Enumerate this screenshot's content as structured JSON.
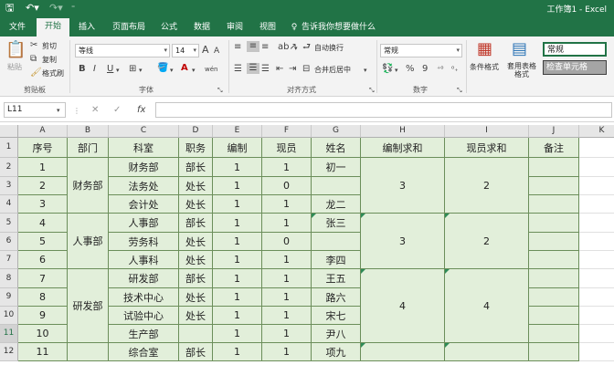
{
  "titlebar": {
    "save_icon": "save-icon",
    "undo_icon": "undo-icon",
    "redo_icon": "redo-icon",
    "title": "工作簿1 - Excel"
  },
  "tabs": [
    "文件",
    "开始",
    "插入",
    "页面布局",
    "公式",
    "数据",
    "审阅",
    "视图"
  ],
  "tell_me": "告诉我你想要做什么",
  "ribbon": {
    "paste": "粘贴",
    "cut": "剪切",
    "copy": "复制",
    "format_painter": "格式刷",
    "font_name": "等线",
    "font_size": "14",
    "grow_font": "A",
    "shrink_font": "A",
    "bold": "B",
    "italic": "I",
    "underline": "U",
    "font_color": "A",
    "wen_label": "wén",
    "wrap_text": "自动换行",
    "merge_center": "合并后居中",
    "number_format": "常规",
    "percent": "%",
    "comma": "9",
    "cond_format": "条件格式",
    "table_format": "套用表格格式",
    "style_normal": "常规",
    "style_check": "检查单元格",
    "groups": {
      "clipboard": "剪贴板",
      "font": "字体",
      "alignment": "对齐方式",
      "number": "数字"
    }
  },
  "formula_bar": {
    "name_box": "L11",
    "fx": "fx",
    "cancel": "✕",
    "enter": "✓",
    "value": ""
  },
  "columns": [
    "A",
    "B",
    "C",
    "D",
    "E",
    "F",
    "G",
    "H",
    "I",
    "J",
    "K"
  ],
  "rows": [
    "1",
    "2",
    "3",
    "4",
    "5",
    "6",
    "7",
    "8",
    "9",
    "10",
    "11",
    "12"
  ],
  "headers": [
    "序号",
    "部门",
    "科室",
    "职务",
    "编制",
    "现员",
    "姓名",
    "编制求和",
    "现员求和",
    "备注"
  ],
  "data": [
    [
      "1",
      "",
      "财务部",
      "部长",
      "1",
      "1",
      "初一"
    ],
    [
      "2",
      "",
      "法务处",
      "处长",
      "1",
      "0",
      ""
    ],
    [
      "3",
      "",
      "会计处",
      "处长",
      "1",
      "1",
      "龙二"
    ],
    [
      "4",
      "",
      "人事部",
      "部长",
      "1",
      "1",
      "张三"
    ],
    [
      "5",
      "",
      "劳务科",
      "处长",
      "1",
      "0",
      ""
    ],
    [
      "6",
      "",
      "人事科",
      "处长",
      "1",
      "1",
      "李四"
    ],
    [
      "7",
      "",
      "研发部",
      "部长",
      "1",
      "1",
      "王五"
    ],
    [
      "8",
      "",
      "技术中心",
      "处长",
      "1",
      "1",
      "路六"
    ],
    [
      "9",
      "",
      "试验中心",
      "处长",
      "1",
      "1",
      "宋七"
    ],
    [
      "10",
      "",
      "生产部",
      "",
      "1",
      "1",
      "尹八"
    ],
    [
      "11",
      "",
      "综合室",
      "部长",
      "1",
      "1",
      "项九"
    ]
  ],
  "departments": [
    "财务部",
    "人事部",
    "研发部"
  ],
  "sum_bianzhi": [
    "3",
    "3",
    "4"
  ],
  "sum_xianyuan": [
    "2",
    "2",
    "4"
  ]
}
